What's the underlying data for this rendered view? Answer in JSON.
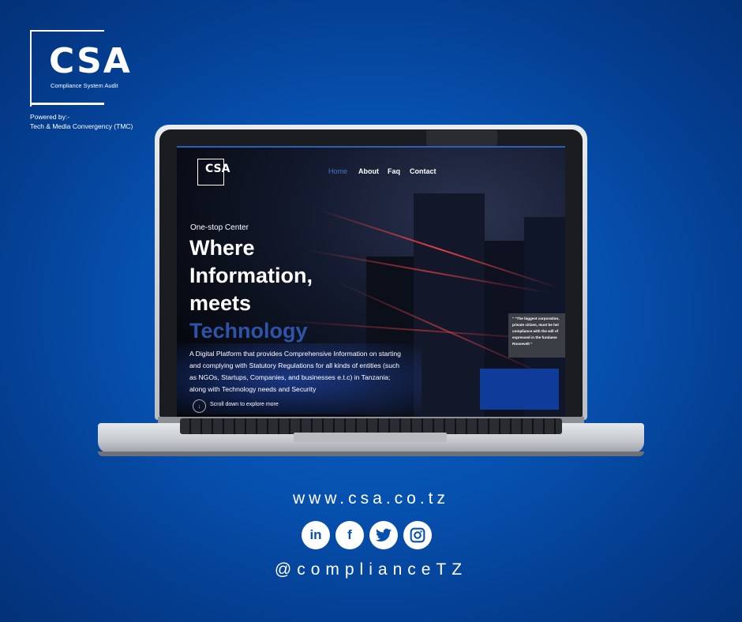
{
  "brand": {
    "logo_text": "CSA",
    "subtitle": "Compliance System Audit",
    "powered_by_1": "Powered by:-",
    "powered_by_2": "Tech & Media Convergency (TMC)"
  },
  "site": {
    "logo_text": "CSA",
    "nav": [
      "Home",
      "About",
      "Faq",
      "Contact"
    ],
    "active_nav": "Home",
    "eyebrow": "One-stop Center",
    "hero_line1": "Where",
    "hero_line2": "Information,",
    "hero_line3": "meets",
    "hero_line4": "Technology",
    "description": "A Digital Platform that provides Comprehensive Information on starting and complying with Statutory Regulations for all kinds of entities (such as NGOs, Startups, Companies, and businesses e.t.c) in Tanzania; along with Technology needs and Security",
    "scroll_text": "Scroll down to explore more",
    "quote_lines": [
      "\" \"The biggest corporation,",
      "private citizen, must be hel",
      "compliance with the will of",
      "expressed in the fundame",
      "Roosevelt \""
    ]
  },
  "footer": {
    "url": "www.csa.co.tz",
    "handle": "@complianceTZ",
    "socials": [
      "linkedin-icon",
      "facebook-icon",
      "twitter-icon",
      "instagram-icon"
    ]
  },
  "colors": {
    "background": "#0650ae",
    "accent": "#2e54a8"
  }
}
